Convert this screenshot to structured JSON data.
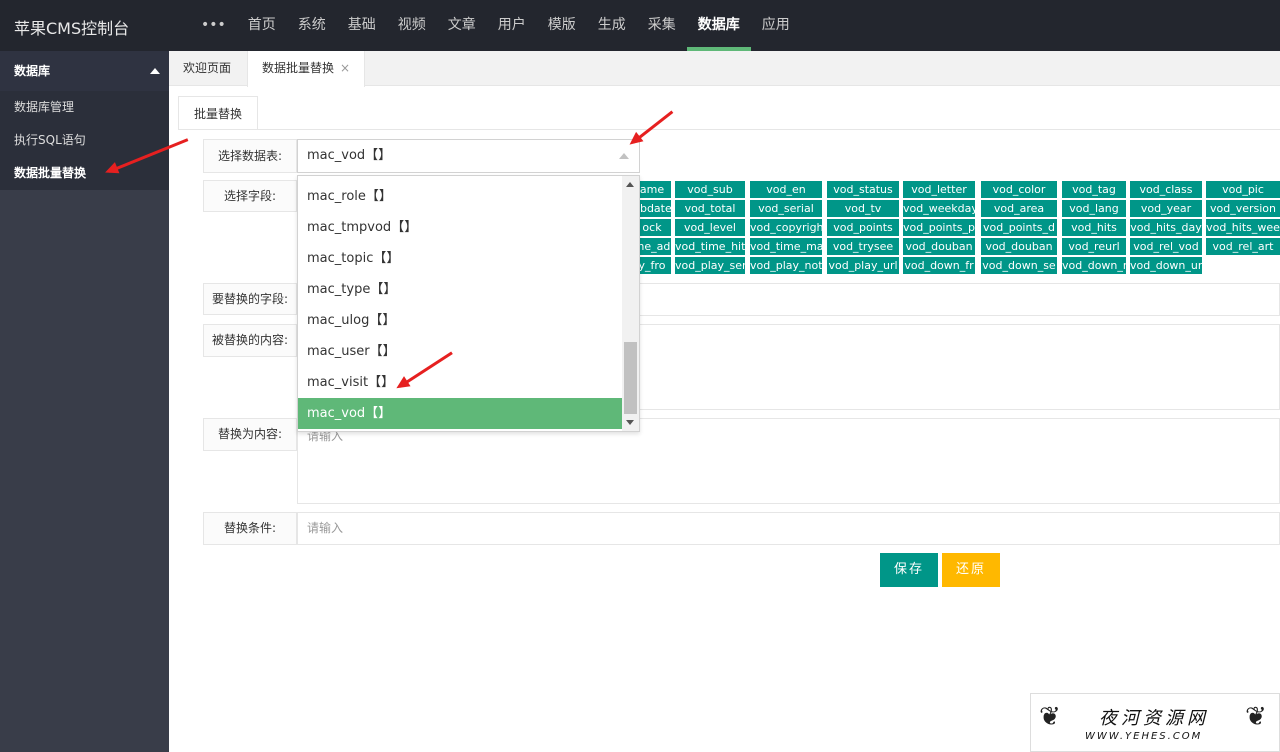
{
  "brand": "苹果CMS控制台",
  "topnav": {
    "more": "•••",
    "items": [
      "首页",
      "系统",
      "基础",
      "视频",
      "文章",
      "用户",
      "模版",
      "生成",
      "采集",
      "数据库",
      "应用"
    ],
    "active": "数据库"
  },
  "sidebar": {
    "header": "数据库",
    "items": [
      "数据库管理",
      "执行SQL语句",
      "数据批量替换"
    ],
    "active": "数据批量替换"
  },
  "tabs": {
    "welcome": "欢迎页面",
    "batch": "数据批量替换",
    "close": "×"
  },
  "subtab": "批量替换",
  "form": {
    "select_table_label": "选择数据表:",
    "select_table_value": "mac_vod【】",
    "select_field_label": "选择字段:",
    "replace_field_label": "要替换的字段:",
    "replaced_content_label": "被替换的内容:",
    "replace_with_label": "替换为内容:",
    "replace_with_placeholder": "请输入",
    "condition_label": "替换条件:",
    "condition_placeholder": "请输入"
  },
  "dropdown": {
    "options": [
      "mac_role【】",
      "mac_tmpvod【】",
      "mac_topic【】",
      "mac_type【】",
      "mac_ulog【】",
      "mac_user【】",
      "mac_visit【】",
      "mac_vod【】"
    ],
    "selected": "mac_vod【】"
  },
  "fields": [
    [
      "ame",
      "vod_sub",
      "vod_en",
      "vod_status",
      "vod_letter",
      "vod_color",
      "vod_tag",
      "vod_class",
      "vod_pic"
    ],
    [
      "ubdate",
      "vod_total",
      "vod_serial",
      "vod_tv",
      "vod_weekday",
      "vod_area",
      "vod_lang",
      "vod_year",
      "vod_version"
    ],
    [
      "ock",
      "vod_level",
      "vod_copyright",
      "vod_points",
      "vod_points_p",
      "vod_points_d",
      "vod_hits",
      "vod_hits_day",
      "vod_hits_wee"
    ],
    [
      "me_ad",
      "vod_time_hits",
      "vod_time_ma",
      "vod_trysee",
      "vod_douban",
      "vod_douban",
      "vod_reurl",
      "vod_rel_vod",
      "vod_rel_art"
    ],
    [
      "y_fro",
      "vod_play_ser",
      "vod_play_not",
      "vod_play_url",
      "vod_down_fr",
      "vod_down_se",
      "vod_down_no",
      "vod_down_ur"
    ]
  ],
  "buttons": {
    "save": "保存",
    "reset": "还原"
  },
  "watermark": {
    "title": "夜河资源网",
    "url": "WWW.YEHES.COM"
  }
}
